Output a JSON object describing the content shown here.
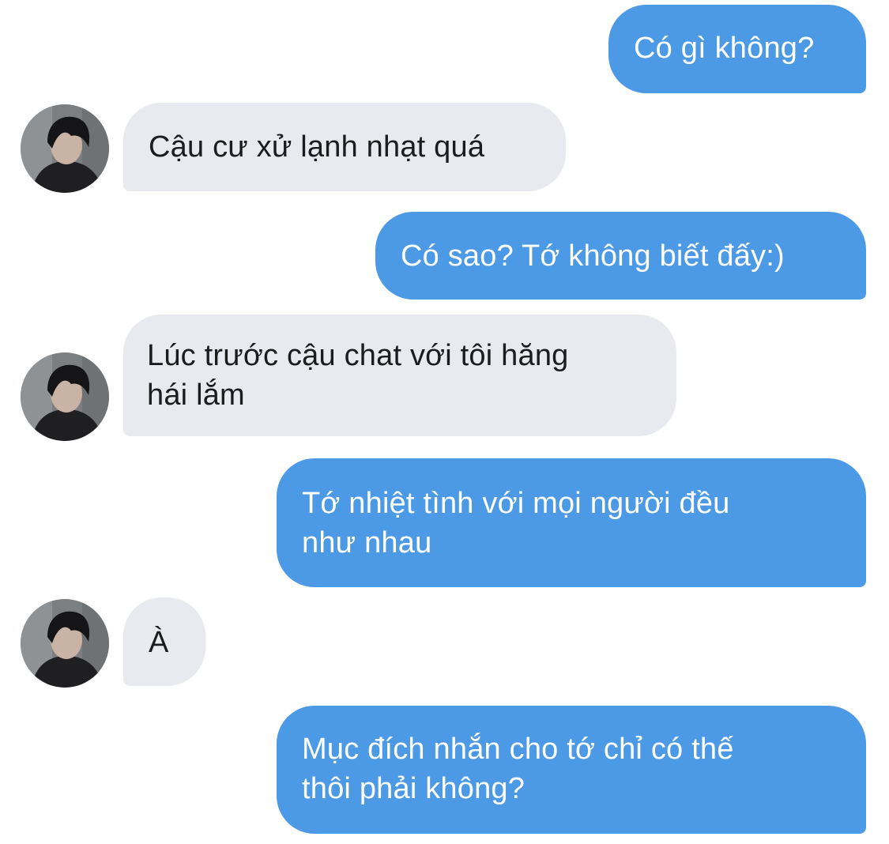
{
  "conversation": {
    "messages": [
      {
        "sender": "me",
        "lines": [
          "Có gì không?"
        ]
      },
      {
        "sender": "them",
        "lines": [
          "Cậu cư xử lạnh nhạt quá"
        ]
      },
      {
        "sender": "me",
        "lines": [
          "Có sao? Tớ không biết đấy:)"
        ]
      },
      {
        "sender": "them",
        "lines": [
          "Lúc trước cậu chat với tôi hăng",
          "hái lắm"
        ]
      },
      {
        "sender": "me",
        "lines": [
          "Tớ nhiệt tình với mọi người đều",
          "như nhau"
        ]
      },
      {
        "sender": "them",
        "lines": [
          "À"
        ]
      },
      {
        "sender": "me",
        "lines": [
          "Mục đích nhắn cho tớ chỉ có thế",
          "thôi phải không?"
        ]
      }
    ]
  },
  "colors": {
    "outgoing_bubble": "#4c9ae6",
    "incoming_bubble": "#e9eaef",
    "outgoing_text": "#ffffff",
    "incoming_text": "#1c1c1e"
  },
  "icons": {
    "avatar": "contact-avatar-photo"
  }
}
